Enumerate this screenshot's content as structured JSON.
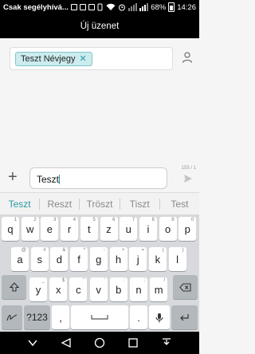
{
  "status_bar": {
    "carrier": "Csak segélyhívá...",
    "battery": "68%",
    "time": "14:26"
  },
  "header": {
    "title": "Új üzenet"
  },
  "recipient": {
    "chip_label": "Teszt Névjegy",
    "remove_symbol": "✕"
  },
  "compose": {
    "text": "Teszt",
    "counter": "155 / 1",
    "add_symbol": "+"
  },
  "suggestions": [
    "Teszt",
    "Reszt",
    "Tröszt",
    "Tiszt",
    "Test"
  ],
  "keyboard": {
    "row1": [
      {
        "k": "q",
        "h": "1"
      },
      {
        "k": "w",
        "h": "2"
      },
      {
        "k": "e",
        "h": "3"
      },
      {
        "k": "r",
        "h": "4"
      },
      {
        "k": "t",
        "h": "5"
      },
      {
        "k": "z",
        "h": "6"
      },
      {
        "k": "u",
        "h": "7"
      },
      {
        "k": "i",
        "h": "8"
      },
      {
        "k": "o",
        "h": "9"
      },
      {
        "k": "p",
        "h": "0"
      }
    ],
    "row2": [
      {
        "k": "a",
        "h": "@"
      },
      {
        "k": "s",
        "h": "#"
      },
      {
        "k": "d",
        "h": "&"
      },
      {
        "k": "f",
        "h": "*"
      },
      {
        "k": "g",
        "h": "-"
      },
      {
        "k": "h",
        "h": "+"
      },
      {
        "k": "j",
        "h": "="
      },
      {
        "k": "k",
        "h": "("
      },
      {
        "k": "l",
        "h": ")"
      }
    ],
    "row3": [
      {
        "k": "y",
        "h": "_"
      },
      {
        "k": "x",
        "h": "$"
      },
      {
        "k": "c",
        "h": "\""
      },
      {
        "k": "v",
        "h": "'"
      },
      {
        "k": "b",
        "h": ":"
      },
      {
        "k": "n",
        "h": ";"
      },
      {
        "k": "m",
        "h": "/"
      }
    ],
    "numbers_label": "?123",
    "comma": ",",
    "period": ".",
    "space_hint": "",
    "accent": "#2a9aa3"
  }
}
